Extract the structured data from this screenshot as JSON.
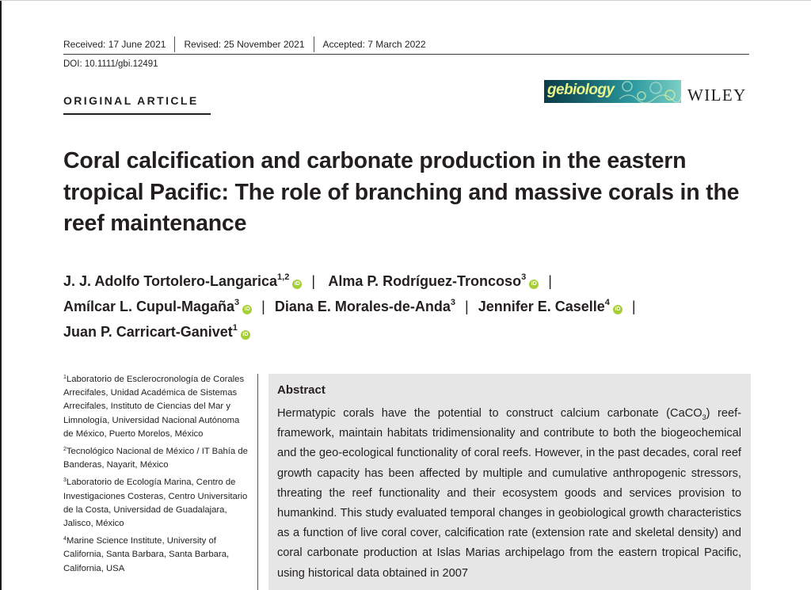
{
  "header": {
    "received": "Received: 17 June 2021",
    "revised": "Revised: 25 November 2021",
    "accepted": "Accepted: 7 March 2022",
    "doi": "DOI: 10.1111/gbi.12491",
    "article_type": "ORIGINAL ARTICLE",
    "journal_logo_text": "gebiology",
    "publisher": "WILEY"
  },
  "title": "Coral calcification and carbonate production in the eastern tropical Pacific: The role of branching and massive corals in the reef maintenance",
  "authors": [
    {
      "name": "J. J. Adolfo Tortolero-Langarica",
      "sup": "1,2"
    },
    {
      "name": "Alma P. Rodríguez-Troncoso",
      "sup": "3"
    },
    {
      "name": "Amílcar L. Cupul-Magaña",
      "sup": "3"
    },
    {
      "name": "Diana E. Morales-de-Anda",
      "sup": "3"
    },
    {
      "name": "Jennifer E. Caselle",
      "sup": "4"
    },
    {
      "name": "Juan P. Carricart-Ganivet",
      "sup": "1"
    }
  ],
  "orcid_label": "iD",
  "separator": "|",
  "affiliations": [
    {
      "sup": "1",
      "text": "Laboratorio de Esclerocronología de Corales Arrecifales, Unidad Académica de Sistemas Arrecifales, Instituto de Ciencias del Mar y Limnología, Universidad Nacional Autónoma de México, Puerto Morelos, México"
    },
    {
      "sup": "2",
      "text": "Tecnológico Nacional de México / IT Bahía de Banderas, Nayarit, México"
    },
    {
      "sup": "3",
      "text": "Laboratorio de Ecología Marina, Centro de Investigaciones Costeras, Centro Universitario de la Costa, Universidad de Guadalajara, Jalisco, México"
    },
    {
      "sup": "4",
      "text": "Marine Science Institute, University of California, Santa Barbara, Santa Barbara, California, USA"
    }
  ],
  "abstract": {
    "heading": "Abstract",
    "text_before": "Hermatypic corals have the potential to construct calcium carbonate (CaCO",
    "subscript": "3",
    "text_after": ") reef-framework, maintain habitats tridimensionality and contribute to both the biogeochemical and the geo-ecological functionality of coral reefs. However, in the past decades, coral reef growth capacity has been affected by multiple and cumulative anthropogenic stressors, threating the reef functionality and their ecosystem goods and services provision to humankind. This study evaluated temporal changes in geobiological growth characteristics as a function of live coral cover, calcification rate (extension rate and skeletal density) and coral carbonate production at Islas Marias archipelago from the eastern tropical Pacific, using historical data obtained in 2007"
  },
  "colors": {
    "orcid": "#a6ce39",
    "abstract_bg": "#e6e6e6",
    "text": "#231f20"
  }
}
